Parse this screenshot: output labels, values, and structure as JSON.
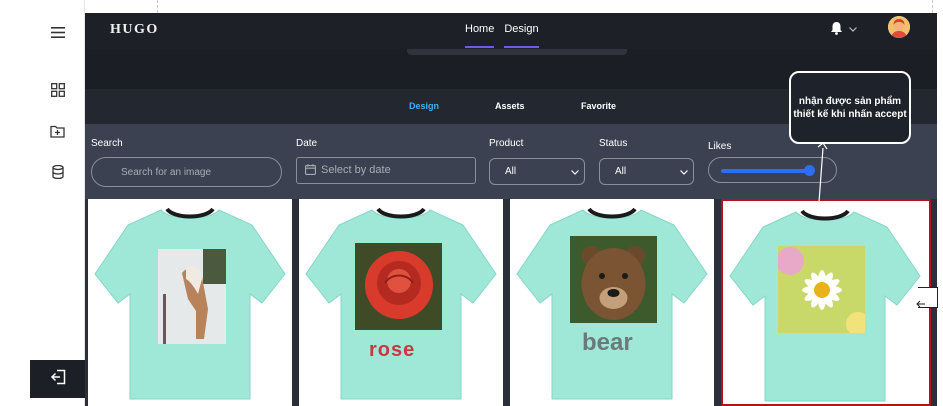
{
  "sidebar": {
    "menu_icon": "hamburger-icon",
    "items": [
      {
        "name": "grid-icon"
      },
      {
        "name": "folder-add-icon"
      },
      {
        "name": "database-icon"
      }
    ],
    "logout_icon": "logout-icon"
  },
  "header": {
    "logo": "HUGO",
    "nav": [
      "Home",
      "Design"
    ],
    "notification_icon": "bell-icon",
    "chevron_icon": "chevron-down-icon"
  },
  "tabs": {
    "items": [
      "Design",
      "Assets",
      "Favorite"
    ],
    "active": "Design"
  },
  "filters": {
    "search": {
      "label": "Search",
      "placeholder": "Search for an image"
    },
    "date": {
      "label": "Date",
      "placeholder": "Select by date"
    },
    "product": {
      "label": "Product",
      "value": "All"
    },
    "status": {
      "label": "Status",
      "value": "All"
    },
    "likes": {
      "label": "Likes",
      "value_fraction": 0.92
    }
  },
  "products": [
    {
      "name": "horse-shirt",
      "print_label": ""
    },
    {
      "name": "rose-shirt",
      "print_label": "rose"
    },
    {
      "name": "bear-shirt",
      "print_label": "bear"
    },
    {
      "name": "daisy-shirt",
      "print_label": "",
      "selected": true
    }
  ],
  "annotation": {
    "text_line1": "nhận được sản phẩm",
    "text_line2": "thiết kế khi nhấn accept"
  },
  "colors": {
    "accent": "#3fb0f0",
    "slider": "#2e6ff2",
    "selection": "#b3121b",
    "shirt": "#9fe8d8"
  }
}
